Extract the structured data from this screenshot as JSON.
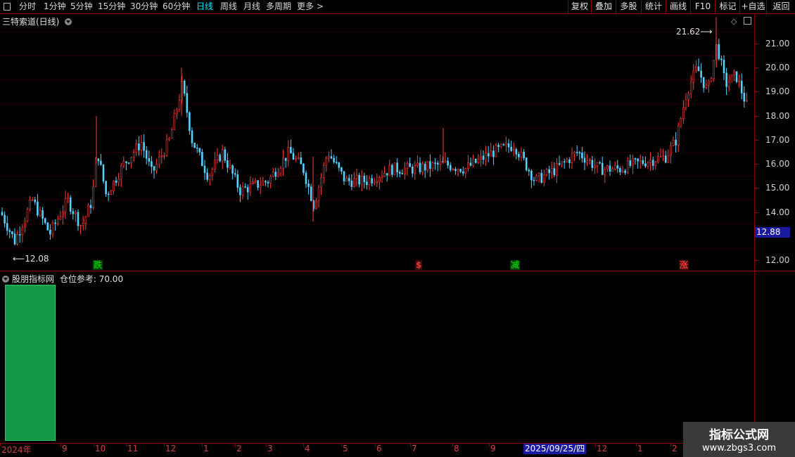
{
  "toolbar": {
    "periods": [
      {
        "label": "分时",
        "active": false
      },
      {
        "label": "1分钟",
        "active": false
      },
      {
        "label": "5分钟",
        "active": false
      },
      {
        "label": "15分钟",
        "active": false
      },
      {
        "label": "30分钟",
        "active": false
      },
      {
        "label": "60分钟",
        "active": false
      },
      {
        "label": "日线",
        "active": true
      },
      {
        "label": "周线",
        "active": false
      },
      {
        "label": "月线",
        "active": false
      },
      {
        "label": "多周期",
        "active": false
      },
      {
        "label": "更多 >",
        "active": false
      }
    ],
    "right_buttons": [
      "复权",
      "叠加",
      "多股",
      "统计",
      "画线",
      "F10",
      "标记",
      "+自选",
      "返回"
    ]
  },
  "main_panel": {
    "title": "三特索道(日线)",
    "high_label": "21.62",
    "low_label": "12.08",
    "current_price": "12.88",
    "y_axis_labels": [
      "21.00",
      "20.00",
      "19.00",
      "18.00",
      "17.00",
      "16.00",
      "15.00",
      "14.00",
      "12.00"
    ],
    "signals": [
      {
        "text": "跌",
        "color": "#00c000"
      },
      {
        "text": "$",
        "color": "#ff3030"
      },
      {
        "text": "减",
        "color": "#00c000"
      },
      {
        "text": "涨",
        "color": "#ff3030"
      }
    ]
  },
  "indicator_panel": {
    "title": "股朋指标网",
    "label": "仓位参考:",
    "value": "70.00",
    "bar_color": "#129a48"
  },
  "x_axis": {
    "labels": [
      "2024年",
      "9",
      "10",
      "11",
      "12",
      "1",
      "2",
      "3",
      "4",
      "5",
      "6",
      "7",
      "8",
      "9",
      "12",
      "1",
      "2"
    ],
    "cursor_date": "2025/09/25/四"
  },
  "watermark": {
    "line1": "指标公式网",
    "line2": "www.zbgs3.com"
  },
  "colors": {
    "up": "#ff3c3c",
    "down": "#54d2ff",
    "grid": "#8b0000"
  }
}
